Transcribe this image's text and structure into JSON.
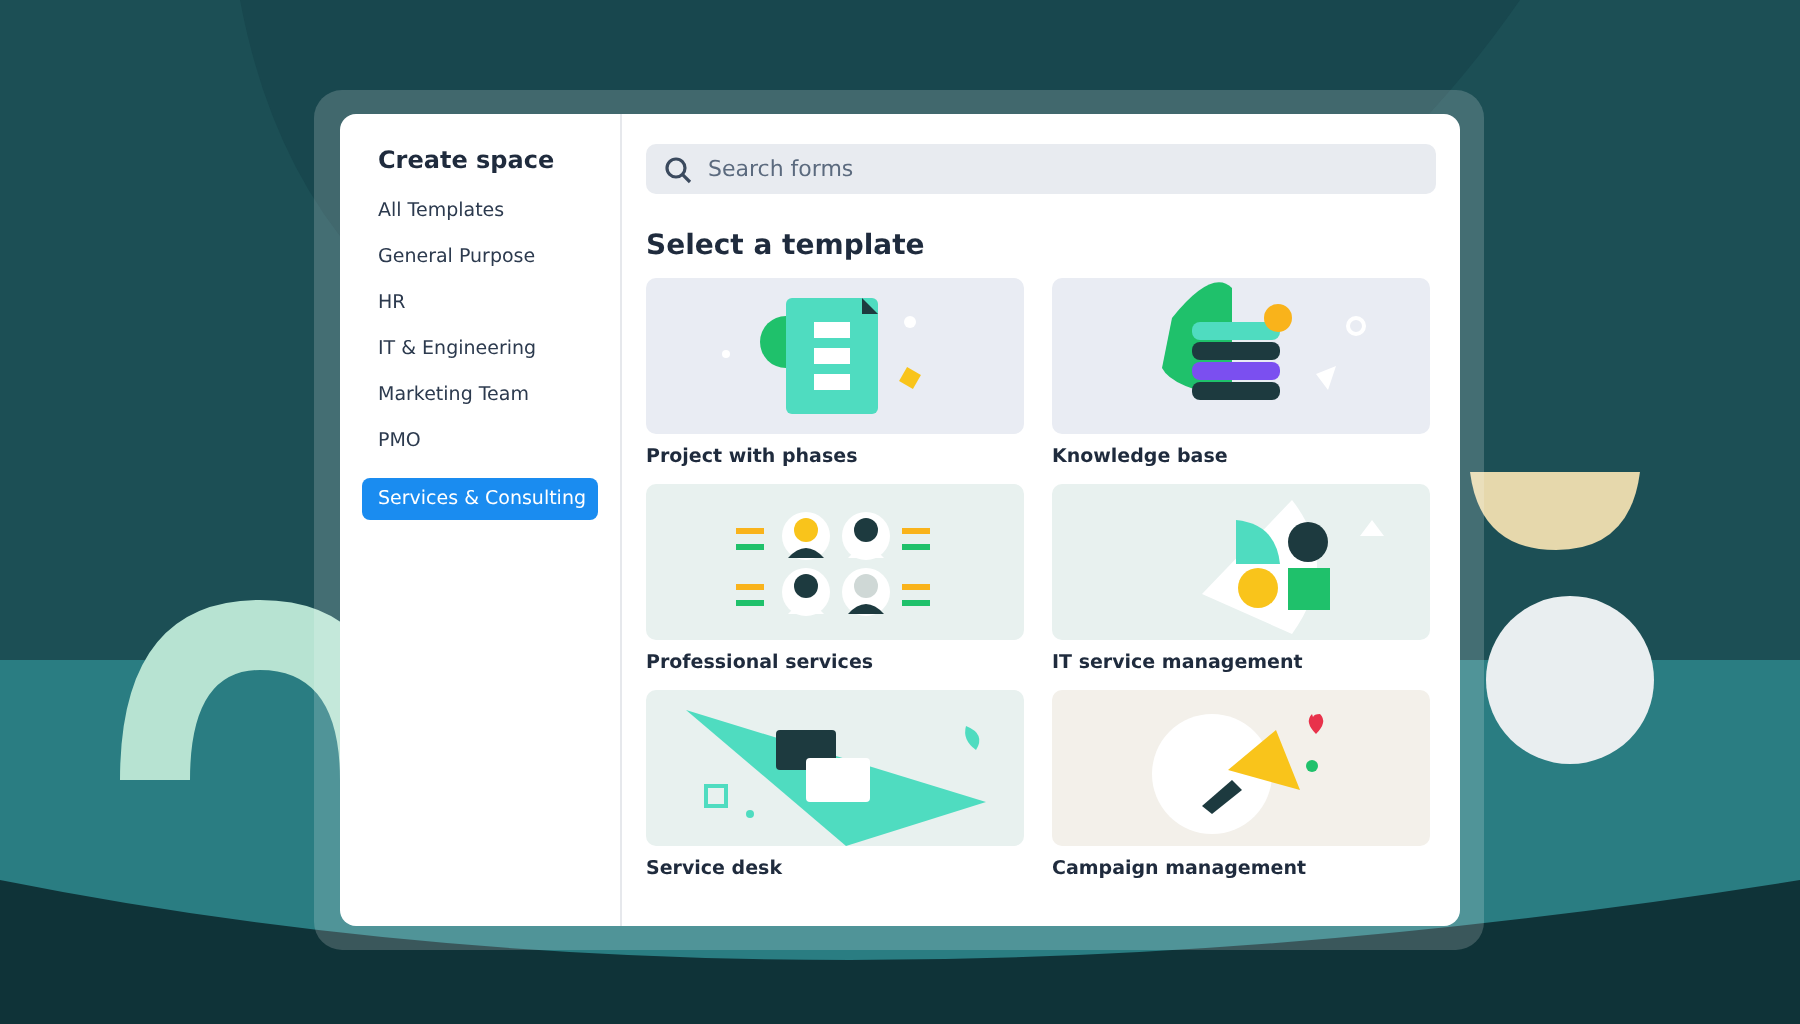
{
  "sidebar": {
    "title": "Create space",
    "items": [
      {
        "label": "All Templates",
        "selected": false
      },
      {
        "label": "General Purpose",
        "selected": false
      },
      {
        "label": "HR",
        "selected": false
      },
      {
        "label": "IT & Engineering",
        "selected": false
      },
      {
        "label": "Marketing Team",
        "selected": false
      },
      {
        "label": "PMO",
        "selected": false
      },
      {
        "label": "Services & Consulting",
        "selected": true
      }
    ]
  },
  "search": {
    "placeholder": "Search forms"
  },
  "heading": "Select a template",
  "templates": [
    {
      "name": "Project with phases",
      "kind": "phases"
    },
    {
      "name": "Knowledge base",
      "kind": "books"
    },
    {
      "name": "Professional services",
      "kind": "people"
    },
    {
      "name": "IT service management",
      "kind": "tools"
    },
    {
      "name": "Service desk",
      "kind": "chat"
    },
    {
      "name": "Campaign management",
      "kind": "megaphone"
    }
  ]
}
